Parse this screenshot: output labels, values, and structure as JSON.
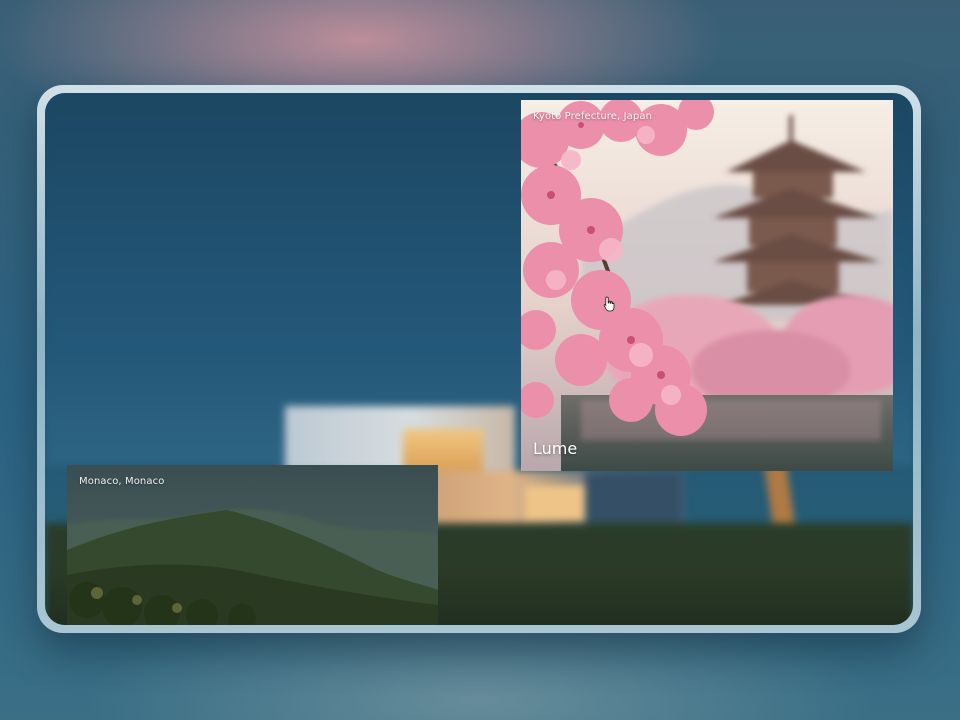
{
  "cards": [
    {
      "location": "Kyoto Prefecture, Japan",
      "title": "Lume"
    },
    {
      "location": "Monaco, Monaco",
      "title": ""
    }
  ],
  "icons": {
    "cursor": "pointer-hand-icon"
  },
  "colors": {
    "backdrop": "#2b6383",
    "frame": "#a9c6d2",
    "screen": "#225a78",
    "blossom": "#e98aa6",
    "label_text": "#ffffff"
  }
}
